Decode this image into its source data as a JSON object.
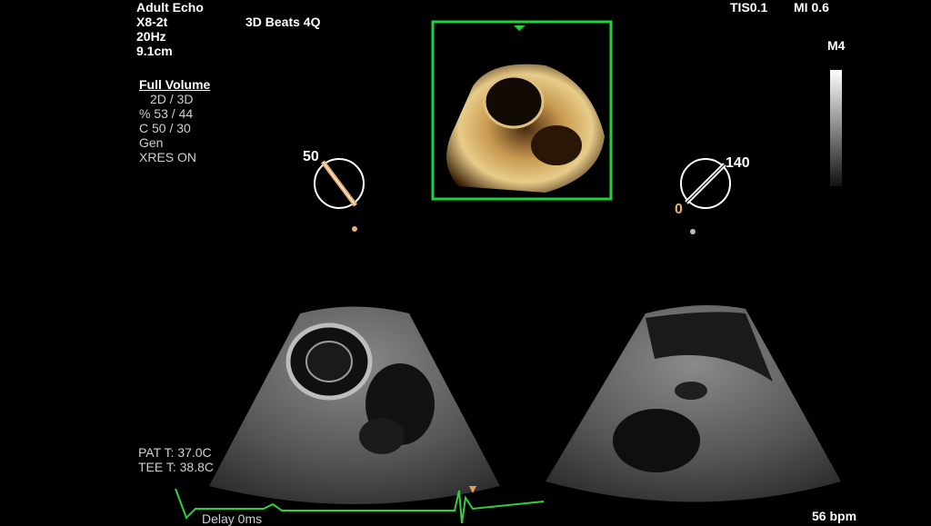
{
  "header": {
    "preset": "Adult Echo",
    "probe": "X8-2t",
    "frame_rate": "20Hz",
    "depth": "9.1cm",
    "mode_title": "3D Beats 4Q",
    "tis": "TIS0.1",
    "mi": "MI 0.6"
  },
  "acquisition": {
    "label": "Full Volume",
    "lines": [
      "2D / 3D",
      "% 53 / 44",
      "C  50 / 30",
      "Gen",
      "XRES ON"
    ]
  },
  "left_plane": {
    "angle": "50"
  },
  "right_plane": {
    "angle": "140",
    "secondary_angle": "0"
  },
  "grayscale": {
    "map_label": "M4"
  },
  "temps": {
    "pat": "PAT T: 37.0C",
    "tee": "TEE T: 38.8C"
  },
  "ecg": {
    "delay": "Delay 0ms",
    "heart_rate": "56 bpm",
    "color": "#2fd23a"
  },
  "colors": {
    "volume_frame": "#1fd13a",
    "marker_orange": "#e8b070"
  }
}
